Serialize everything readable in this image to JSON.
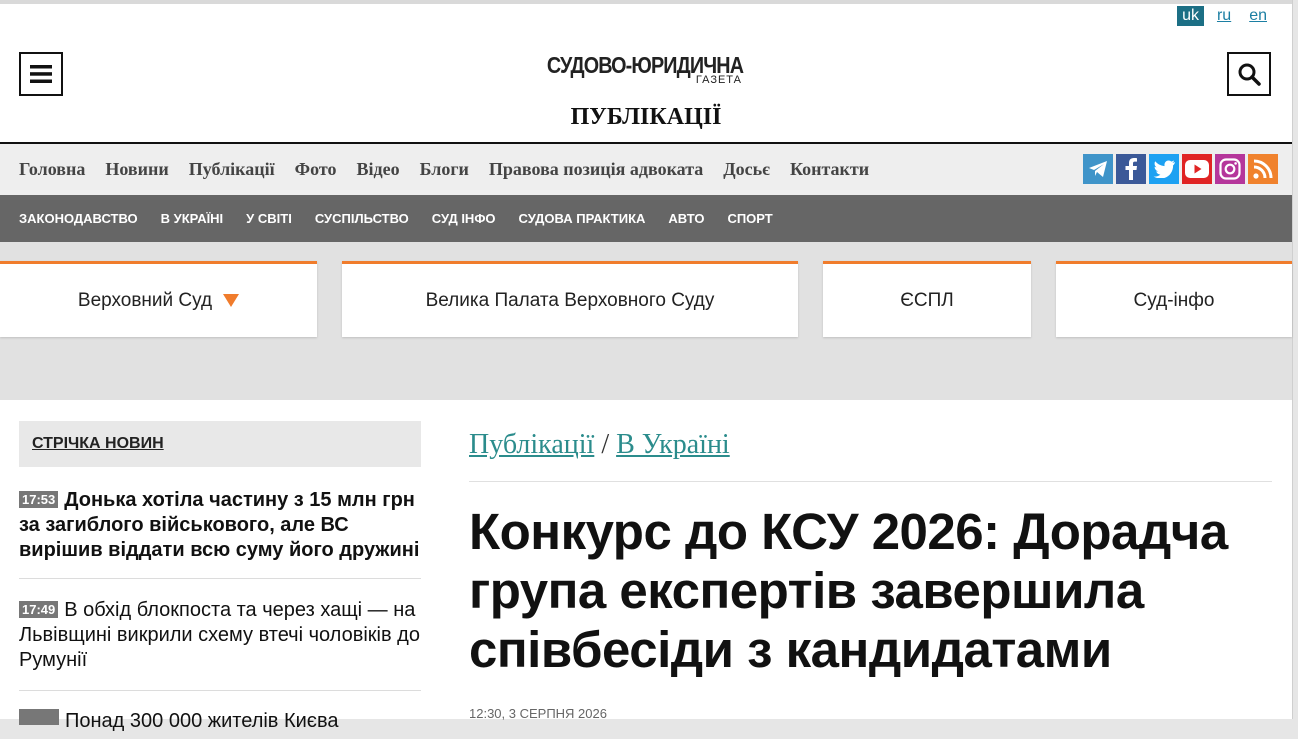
{
  "langs": [
    "uk",
    "ru",
    "en"
  ],
  "active_lang": "uk",
  "logo": {
    "main": "СУДОВО-ЮРИДИЧНА",
    "sub": "ГАЗЕТА"
  },
  "section_title": "ПУБЛІКАЦІЇ",
  "main_nav": [
    "Головна",
    "Новини",
    "Публікації",
    "Фото",
    "Відео",
    "Блоги",
    "Правова позиція адвоката",
    "Досьє",
    "Контакти"
  ],
  "socials": [
    {
      "icon": "telegram-icon",
      "color": "#3f94c9"
    },
    {
      "icon": "facebook-icon",
      "color": "#3b5998"
    },
    {
      "icon": "twitter-icon",
      "color": "#1da1f2"
    },
    {
      "icon": "youtube-icon",
      "color": "#e02424"
    },
    {
      "icon": "instagram-icon",
      "color": "#b5369b"
    },
    {
      "icon": "rss-icon",
      "color": "#f0822d"
    }
  ],
  "sub_nav": [
    "ЗАКОНОДАВСТВО",
    "В УКРАЇНІ",
    "У СВІТІ",
    "СУСПІЛЬСТВО",
    "СУД ІНФО",
    "СУДОВА ПРАКТИКА",
    "АВТО",
    "СПОРТ"
  ],
  "court_tabs": [
    {
      "label": "Верховний Суд",
      "dropdown": true
    },
    {
      "label": "Велика Палата Верховного Суду",
      "dropdown": false
    },
    {
      "label": "ЄСПЛ",
      "dropdown": false
    },
    {
      "label": "Суд-інфо",
      "dropdown": false
    }
  ],
  "news_feed": {
    "heading": "СТРІЧКА НОВИН",
    "items": [
      {
        "time": "17:53",
        "text": "Донька хотіла частину з 15 млн грн за загиблого військового, але ВС вирішив віддати всю суму його дружині",
        "bold": true
      },
      {
        "time": "17:49",
        "text": "В обхід блокпоста та через хащі — на Львівщині викрили схему втечі чоловіків до Румунії",
        "bold": false
      },
      {
        "time": "",
        "text": "Понад 300 000 жителів Києва",
        "bold": false
      }
    ]
  },
  "article": {
    "breadcrumb": [
      "Публікації",
      "В Україні"
    ],
    "breadcrumb_sep": "/",
    "title": "Конкурс до КСУ 2026: Дорадча група експертів завершила співбесіди з кандидатами",
    "date": "12:30, 3 СЕРПНЯ 2026"
  },
  "colors": {
    "accent": "#f07c2c",
    "link": "#2b8c8c",
    "subnav_bg": "#666666",
    "lang_active": "#1c6f85"
  }
}
